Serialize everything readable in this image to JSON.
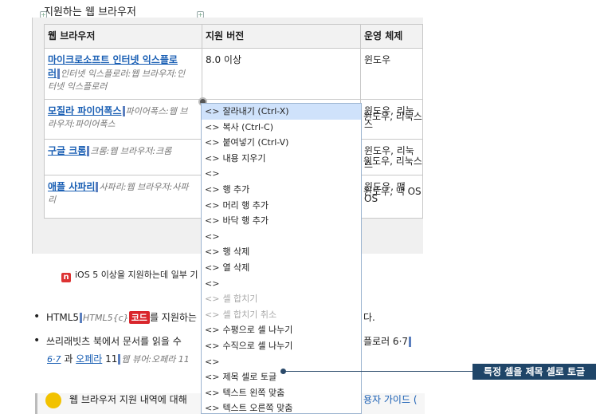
{
  "caption": "지원하는 웹 브라우저",
  "table": {
    "headers": [
      "웹 브라우저",
      "지원 버전",
      "운영 체제"
    ],
    "rows": [
      {
        "name_line1": "마이크로소프트 인터넷 익스플로",
        "name_line2": "러",
        "note1": "인터넷 익스플로러:웹 브라우저:인",
        "note2": "터넷 익스플로러",
        "version": "8.0 이상",
        "os": "윈도우"
      },
      {
        "name": "모질라 파이어폭스",
        "note1": "파이어폭스:웹 브",
        "note2": "라우저:파이어폭스",
        "version": "",
        "os": "윈도우, 리눅스"
      },
      {
        "name": "구글 크롬",
        "note1": "크롬:웹 브라우저:크롬",
        "version": "",
        "os": "윈도우, 리눅스"
      },
      {
        "name": "애플 사파리",
        "note1": "사파리:웹 브라우저:사파",
        "note2": "리",
        "version": "",
        "os": "윈도우, 맥 OS"
      }
    ]
  },
  "note": "iOS 5 이상을 지원하는데 일부 기",
  "note_icon": "n",
  "bullets": {
    "b1_pre": "HTML5",
    "b1_tag": "HTML5{c}",
    "b1_code": "코드",
    "b1_post": "를 지원하는",
    "b1_end": "다.",
    "b2_pre": "쓰리래빗츠 북에서 문서를 읽을 수",
    "b2_end": "플로러 6·7",
    "b3_num": "6·7",
    "b3_mid": " 과 ",
    "b3_link": "오페라",
    "b3_ver": " 11",
    "b3_note": "웹 뷰어:오페라 11"
  },
  "bottom": {
    "text": "웹 브라우저 지원 내역에 대해",
    "right": "용자 가이드 ("
  },
  "menu": [
    {
      "label": "잘라내기 (Ctrl-X)",
      "state": "highlight"
    },
    {
      "label": "복사 (Ctrl-C)",
      "state": "normal"
    },
    {
      "label": "붙여넣기 (Ctrl-V)",
      "state": "normal"
    },
    {
      "label": "내용 지우기",
      "state": "normal"
    },
    {
      "label": "",
      "state": "normal"
    },
    {
      "label": "행 추가",
      "state": "normal"
    },
    {
      "label": "머리 행 추가",
      "state": "normal"
    },
    {
      "label": "바닥 행 추가",
      "state": "normal"
    },
    {
      "label": "",
      "state": "normal"
    },
    {
      "label": "행 삭제",
      "state": "normal"
    },
    {
      "label": "열 삭제",
      "state": "normal"
    },
    {
      "label": "",
      "state": "normal"
    },
    {
      "label": "셀 합치기",
      "state": "disabled"
    },
    {
      "label": "셀 합치기 취소",
      "state": "disabled"
    },
    {
      "label": "수평으로 셀 나누기",
      "state": "normal"
    },
    {
      "label": "수직으로 셀 나누기",
      "state": "normal"
    },
    {
      "label": "",
      "state": "normal"
    },
    {
      "label": "제목 셀로 토글",
      "state": "normal"
    },
    {
      "label": "텍스트 왼쪽 맞춤",
      "state": "normal"
    },
    {
      "label": "텍스트 오른쪽 맞춤",
      "state": "normal"
    }
  ],
  "menu_arrow": "<>",
  "callout": "특정 셀을 제목 셀로 토글",
  "colors": {
    "accent": "#1f4568",
    "highlight": "#cfe2fb",
    "link": "#1a5fb4",
    "code": "#d9262c"
  }
}
